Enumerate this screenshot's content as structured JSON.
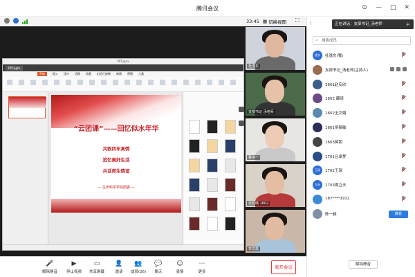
{
  "window": {
    "title": "腾讯会议"
  },
  "topbar": {
    "timer": "33:45",
    "grid_label": "切换视图"
  },
  "share": {
    "window_title": "PPT.pptx",
    "tab_label": "PPT.pptx",
    "ribbon_tabs": [
      "开始",
      "插入",
      "设计",
      "切换",
      "动画",
      "幻灯片放映",
      "审阅",
      "视图",
      "工具"
    ],
    "slide": {
      "title": "“云团课”——回忆似水年华",
      "lines": [
        "共叙四年真情",
        "追忆美好生活",
        "共话师生情谊"
      ],
      "org": "— 生命科学学院团委 —"
    }
  },
  "tiles": [
    {
      "name": "杜逸东",
      "skin": "#e0b8a0",
      "shirt": "#6a6a6a",
      "bg": "#cfd4dc"
    },
    {
      "name": "支部书记 汤老师",
      "skin": "#e6c2a8",
      "shirt": "#333333",
      "bg": "#4a6a4a"
    },
    {
      "name": "曹中一",
      "skin": "#ecccb4",
      "shirt": "#c9c9c9",
      "bg": "#e8e6e2"
    },
    {
      "name": "张碧晴 1602",
      "skin": "#e4bea2",
      "shirt": "#b63a3a",
      "bg": "#d8d2c8"
    },
    {
      "name": "李思霞",
      "skin": "#e2bca2",
      "shirt": "#a9c3da",
      "bg": "#c9b7a9"
    }
  ],
  "toolbar": {
    "buttons": [
      {
        "label": "解除静音",
        "icon": "mic-icon"
      },
      {
        "label": "停止视频",
        "icon": "video-icon"
      },
      {
        "label": "共享屏幕",
        "icon": "screen-share-icon"
      },
      {
        "label": "邀请",
        "icon": "invite-icon"
      },
      {
        "label": "成员(26)",
        "icon": "members-icon"
      },
      {
        "label": "聊天",
        "icon": "chat-icon"
      },
      {
        "label": "表情",
        "icon": "emoji-icon"
      },
      {
        "label": "更多",
        "icon": "more-icon"
      }
    ],
    "leave": "离开会议"
  },
  "panel": {
    "speaking": "正在讲话：支部书记_汤老师",
    "search_placeholder": "搜索成员",
    "members": [
      {
        "name": "杜逸东(我)",
        "avatar": "逸东",
        "color": "#2c6fd6",
        "kind": "muted"
      },
      {
        "name": "支部书记_汤老师(主持人)",
        "avatar": "",
        "color": "#9a6b4f",
        "kind": "host"
      },
      {
        "name": "1601赵安欣",
        "avatar": "",
        "color": "#3a5f8a",
        "kind": "muted"
      },
      {
        "name": "1602 薛晴",
        "avatar": "",
        "color": "#6b4a8a",
        "kind": "muted"
      },
      {
        "name": "1602王文娟",
        "avatar": "",
        "color": "#5a8ab0",
        "kind": "muted"
      },
      {
        "name": "1601吴毓敏",
        "avatar": "",
        "color": "#2d2d5a",
        "kind": "muted"
      },
      {
        "name": "1603蒋钥",
        "avatar": "",
        "color": "#444",
        "kind": "muted"
      },
      {
        "name": "1701吕卓梦",
        "avatar": "",
        "color": "#2a4e8a",
        "kind": "muted"
      },
      {
        "name": "1702王琛",
        "avatar": "王琛",
        "color": "#2c6fd6",
        "kind": "muted"
      },
      {
        "name": "1703周立夫",
        "avatar": "立夫",
        "color": "#2c6fd6",
        "kind": "muted"
      },
      {
        "name": "187****1912",
        "avatar": "",
        "color": "#3c8ad6",
        "kind": "muted"
      },
      {
        "name": "陈一赫",
        "avatar": "",
        "color": "#7f8fa8",
        "kind": "mute-button"
      }
    ],
    "mute_label": "静音",
    "unmute_all": "解除静音"
  }
}
